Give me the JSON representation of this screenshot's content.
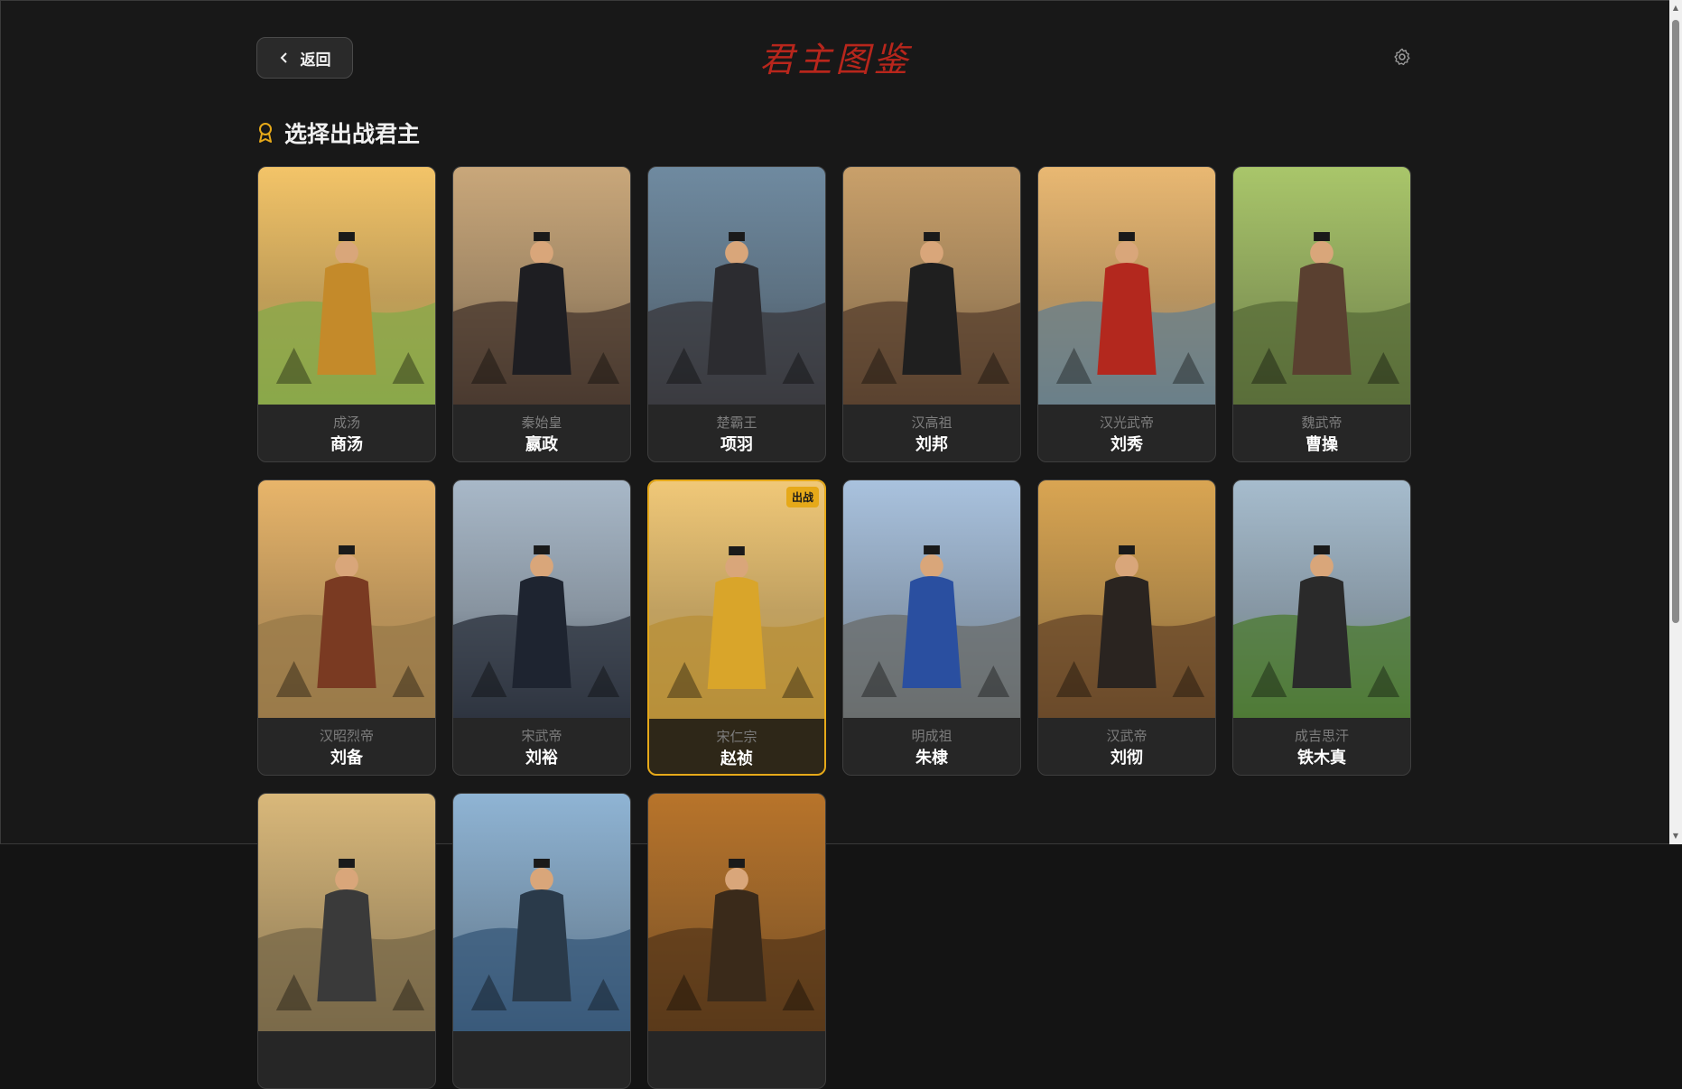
{
  "header": {
    "back_label": "返回",
    "title": "君主图鉴"
  },
  "section": {
    "title": "选择出战君主"
  },
  "selected_badge": "出战",
  "cards": [
    {
      "title": "成汤",
      "name": "商汤",
      "sky": "#f3c468",
      "ground": "#8aa84a",
      "robe": "#c48a2a",
      "selected": false
    },
    {
      "title": "秦始皇",
      "name": "嬴政",
      "sky": "#c9a77a",
      "ground": "#4a3a30",
      "robe": "#1e1e22",
      "selected": false
    },
    {
      "title": "楚霸王",
      "name": "项羽",
      "sky": "#6f8aa0",
      "ground": "#3b3b40",
      "robe": "#2c2c30",
      "selected": false
    },
    {
      "title": "汉高祖",
      "name": "刘邦",
      "sky": "#c9a06a",
      "ground": "#5a4230",
      "robe": "#1f1f1f",
      "selected": false
    },
    {
      "title": "汉光武帝",
      "name": "刘秀",
      "sky": "#e9b872",
      "ground": "#6a7f8a",
      "robe": "#b3281e",
      "selected": false
    },
    {
      "title": "魏武帝",
      "name": "曹操",
      "sky": "#a9c66a",
      "ground": "#5a6e3a",
      "robe": "#5a4030",
      "selected": false
    },
    {
      "title": "汉昭烈帝",
      "name": "刘备",
      "sky": "#e8b56a",
      "ground": "#9a7a4a",
      "robe": "#7a3a22",
      "selected": false
    },
    {
      "title": "宋武帝",
      "name": "刘裕",
      "sky": "#a8b8c8",
      "ground": "#2e3440",
      "robe": "#1e2430",
      "selected": false
    },
    {
      "title": "宋仁宗",
      "name": "赵祯",
      "sky": "#f0c878",
      "ground": "#b8903a",
      "robe": "#d9a52a",
      "selected": true
    },
    {
      "title": "明成祖",
      "name": "朱棣",
      "sky": "#a9c2de",
      "ground": "#6a6e6e",
      "robe": "#2a4fa0",
      "selected": false
    },
    {
      "title": "汉武帝",
      "name": "刘彻",
      "sky": "#d9a552",
      "ground": "#6a4a2a",
      "robe": "#2a2420",
      "selected": false
    },
    {
      "title": "成吉思汗",
      "name": "铁木真",
      "sky": "#a6bccd",
      "ground": "#4f7a36",
      "robe": "#2a2a2a",
      "selected": false
    },
    {
      "title": "",
      "name": "",
      "sky": "#d9b87a",
      "ground": "#7a6a4a",
      "robe": "#3a3a3a",
      "selected": false
    },
    {
      "title": "",
      "name": "",
      "sky": "#8fb4d4",
      "ground": "#3a5a7a",
      "robe": "#2a3a4a",
      "selected": false
    },
    {
      "title": "",
      "name": "",
      "sky": "#b8742a",
      "ground": "#5a3a1a",
      "robe": "#3a2a1a",
      "selected": false
    }
  ]
}
